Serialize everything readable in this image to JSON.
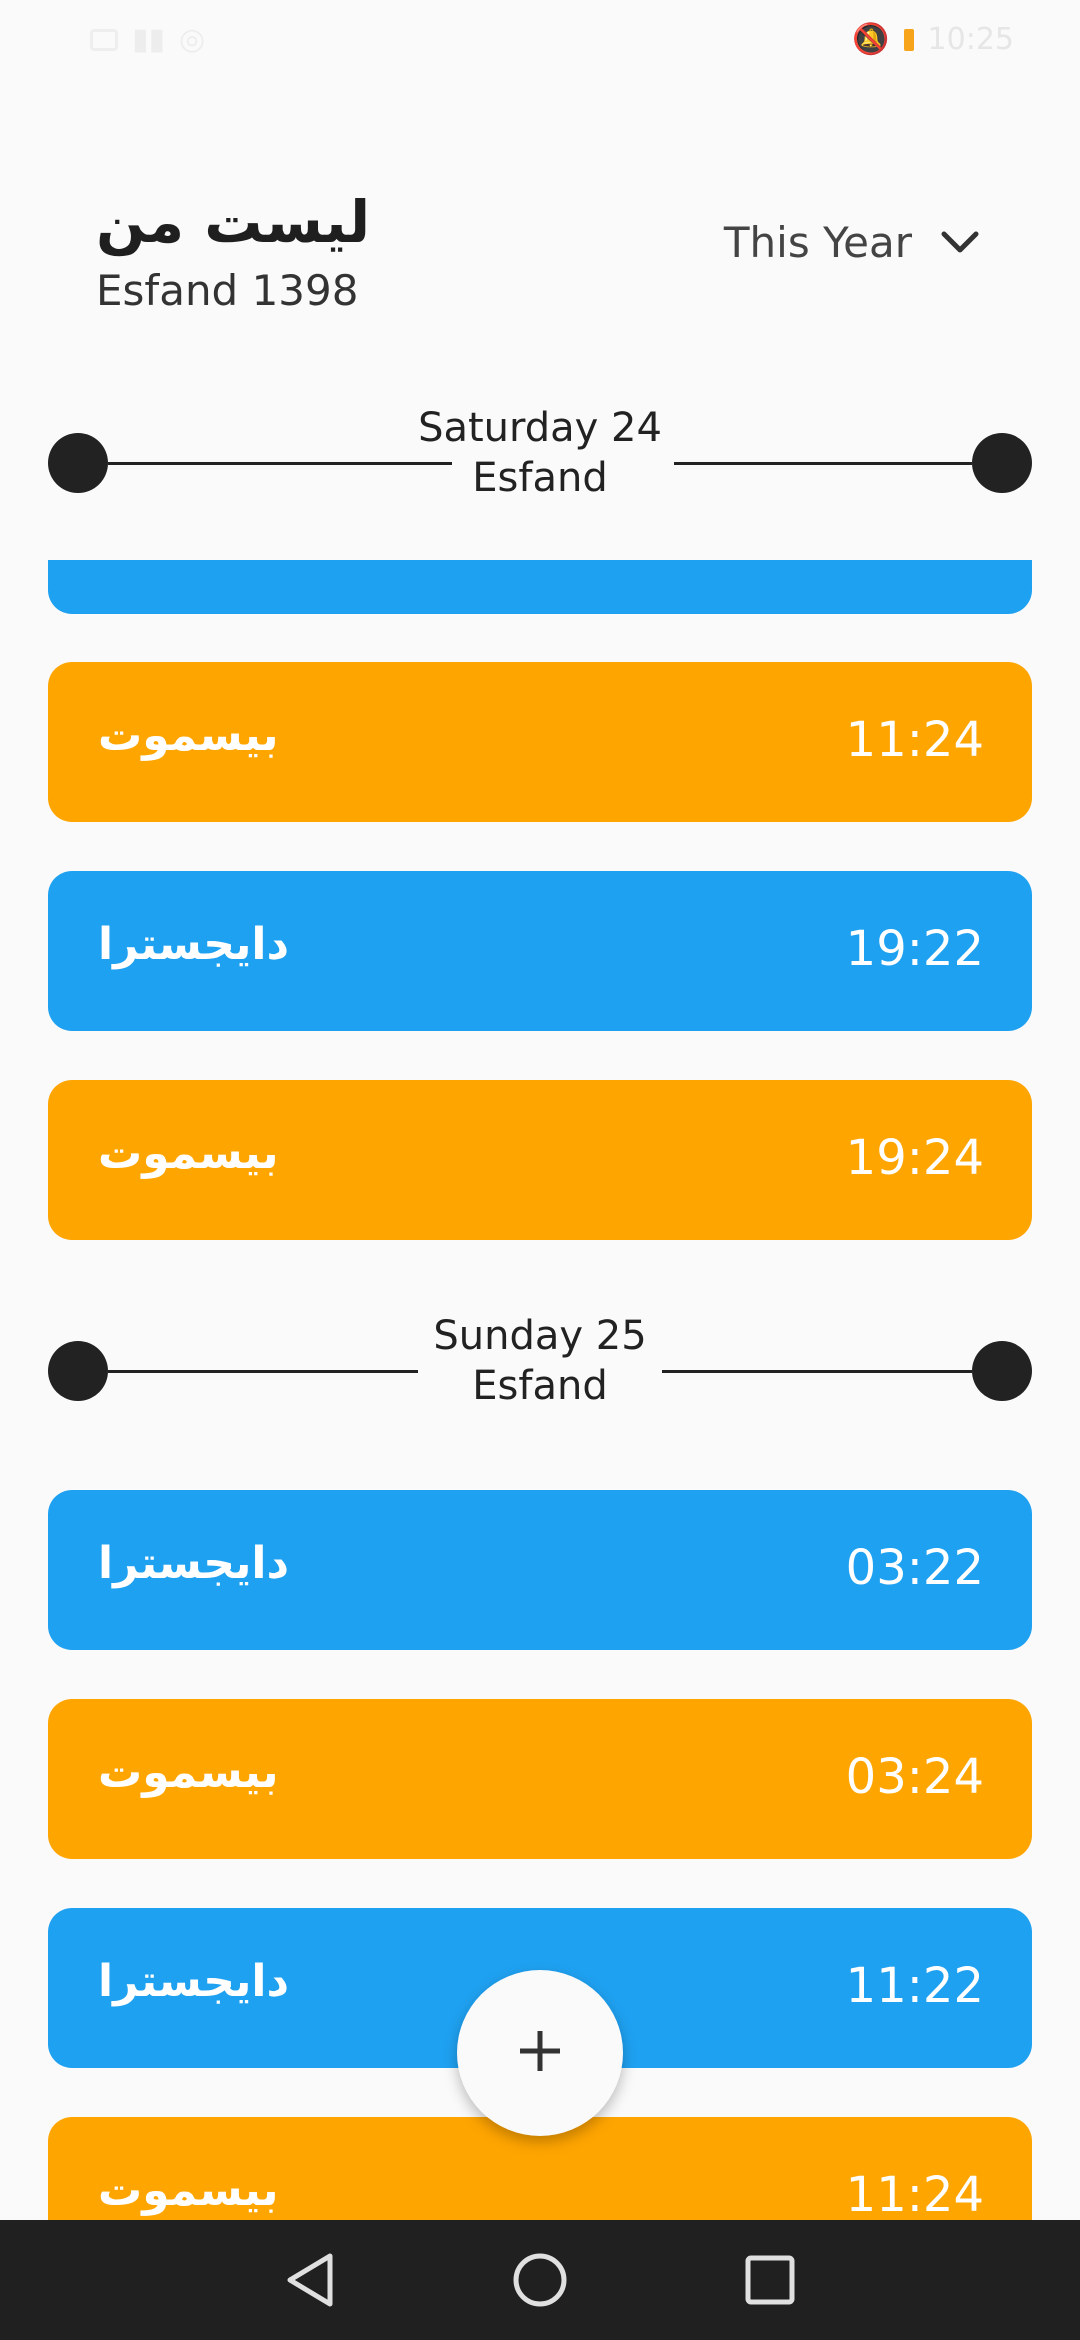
{
  "status": {
    "time": "10:25"
  },
  "header": {
    "title": "لیست من",
    "subtitle": "Esfand 1398",
    "filter_label": "This Year"
  },
  "dates": [
    {
      "line1": "Saturday 24",
      "line2": "Esfand"
    },
    {
      "line1": "Sunday 25",
      "line2": "Esfand"
    }
  ],
  "entries": [
    {
      "name": "بیسموت",
      "time": "11:24",
      "color": "#ffa500"
    },
    {
      "name": "دایجسترا",
      "time": "19:22",
      "color": "#1fa1f1"
    },
    {
      "name": "بیسموت",
      "time": "19:24",
      "color": "#ffa500"
    },
    {
      "name": "دایجسترا",
      "time": "03:22",
      "color": "#1fa1f1"
    },
    {
      "name": "بیسموت",
      "time": "03:24",
      "color": "#ffa500"
    },
    {
      "name": "دایجسترا",
      "time": "11:22",
      "color": "#1fa1f1"
    },
    {
      "name": "بیسموت",
      "time": "11:24",
      "color": "#ffa500"
    }
  ],
  "icons": {
    "filter": "chevron-down-icon",
    "fab": "plus-icon",
    "nav": [
      "back-icon",
      "home-icon",
      "recents-icon"
    ]
  }
}
